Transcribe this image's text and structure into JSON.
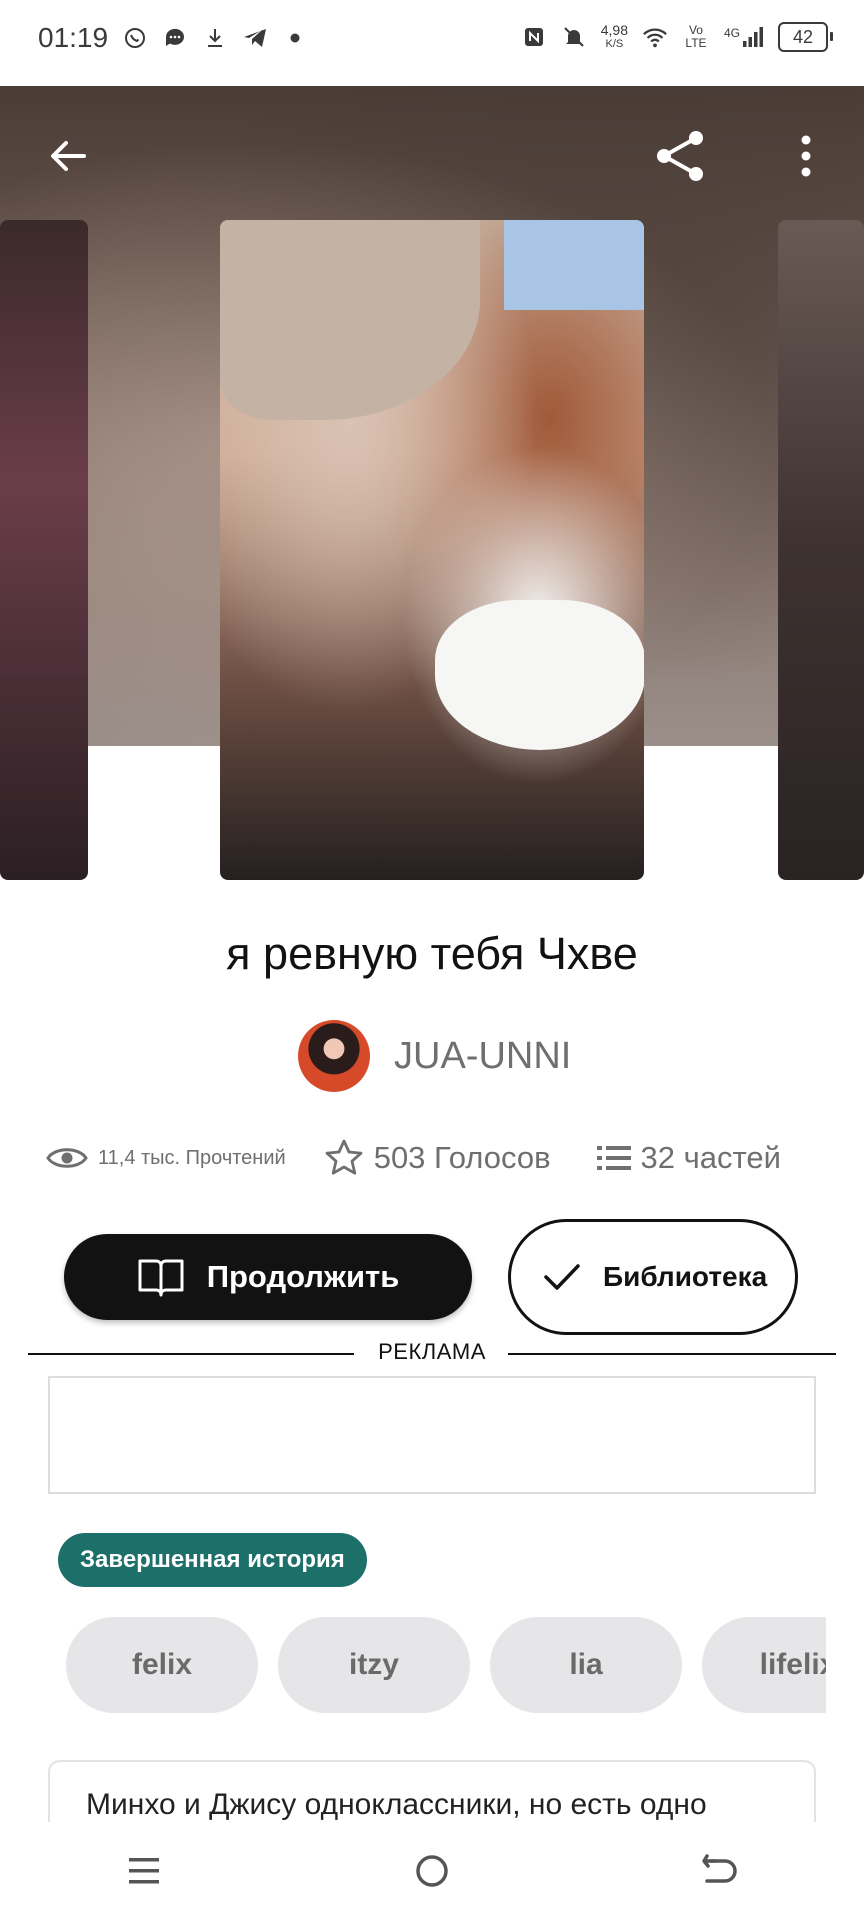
{
  "status_bar": {
    "time": "01:19",
    "net_speed_value": "4,98",
    "net_speed_unit": "K/S",
    "volte": "Vo LTE",
    "network": "4G",
    "battery": "42",
    "icons": [
      "whatsapp-icon",
      "messages-icon",
      "download-icon",
      "telegram-icon",
      "dot-icon",
      "nfc-icon",
      "mute-icon",
      "wifi-icon",
      "signal-icon",
      "battery-icon"
    ]
  },
  "top_nav": {
    "icons": [
      "back-arrow-icon",
      "share-icon",
      "more-vertical-icon"
    ]
  },
  "story": {
    "title": "я ревную тебя Чхве",
    "author": "JUA-UNNI",
    "reads": "11,4 тыс. Прочтений",
    "votes": "503 Голосов",
    "parts": "32 частей"
  },
  "actions": {
    "continue_label": "Продолжить",
    "library_label": "Библиотека"
  },
  "ad": {
    "label": "РЕКЛАМА"
  },
  "status_badge": "Завершенная история",
  "tags": [
    "felix",
    "itzy",
    "lia",
    "lifelix"
  ],
  "description": "Минхо и Джису одноклассники, но есть одно",
  "system_nav": {
    "icons": [
      "recent-apps-icon",
      "home-icon",
      "back-icon"
    ]
  },
  "colors": {
    "badge": "#1d6f6a",
    "button_primary": "#121212",
    "tag_bg": "#e6e6e8"
  }
}
